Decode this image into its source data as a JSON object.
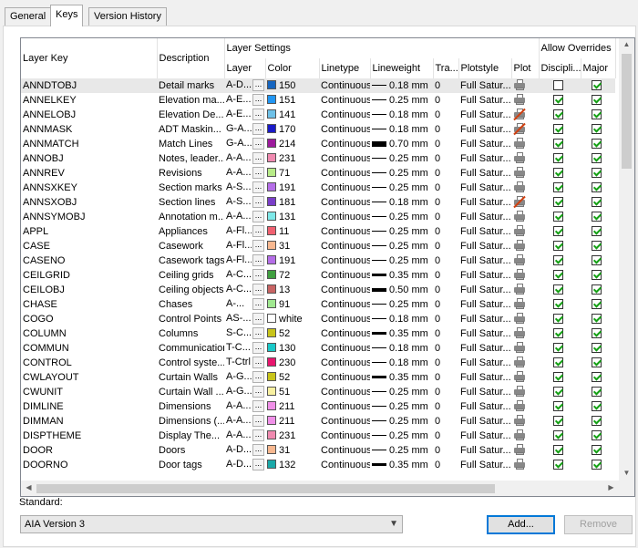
{
  "tabs": [
    "General",
    "Keys",
    "Version History"
  ],
  "headers": {
    "layer_key": "Layer Key",
    "description": "Description",
    "layer_settings": "Layer Settings",
    "layer": "Layer",
    "color": "Color",
    "linetype": "Linetype",
    "lineweight": "Lineweight",
    "transparency": "Tra...",
    "plotstyle": "Plotstyle",
    "plot": "Plot",
    "allow_overrides": "Allow Overrides",
    "discipline": "Discipli...",
    "major": "Major"
  },
  "browse_glyph": "...",
  "rows": [
    {
      "key": "ANNDTOBJ",
      "desc": "Detail marks",
      "layer": "A-D...",
      "color_hex": "#1565c0",
      "color": "150",
      "linetype": "Continuous",
      "lw": "0.18 mm",
      "tr": "0",
      "plotstyle": "Full Satur...",
      "plot": true,
      "disc": false,
      "major": true
    },
    {
      "key": "ANNELKEY",
      "desc": "Elevation ma...",
      "layer": "A-E...",
      "color_hex": "#2196f3",
      "color": "151",
      "linetype": "Continuous",
      "lw": "0.25 mm",
      "tr": "0",
      "plotstyle": "Full Satur...",
      "plot": true,
      "disc": true,
      "major": true
    },
    {
      "key": "ANNELOBJ",
      "desc": "Elevation De...",
      "layer": "A-E...",
      "color_hex": "#6ec1e8",
      "color": "141",
      "linetype": "Continuous",
      "lw": "0.18 mm",
      "tr": "0",
      "plotstyle": "Full Satur...",
      "plot": false,
      "disc": true,
      "major": true
    },
    {
      "key": "ANNMASK",
      "desc": "ADT Maskin...",
      "layer": "G-A...",
      "color_hex": "#1a1ac8",
      "color": "170",
      "linetype": "Continuous",
      "lw": "0.18 mm",
      "tr": "0",
      "plotstyle": "Full Satur...",
      "plot": false,
      "disc": true,
      "major": true
    },
    {
      "key": "ANNMATCH",
      "desc": "Match Lines",
      "layer": "G-A...",
      "color_hex": "#9c1a9c",
      "color": "214",
      "linetype": "Continuous",
      "lw": "0.70 mm",
      "tr": "0",
      "plotstyle": "Full Satur...",
      "plot": true,
      "disc": true,
      "major": true
    },
    {
      "key": "ANNOBJ",
      "desc": "Notes, leader...",
      "layer": "A-A...",
      "color_hex": "#f08ab0",
      "color": "231",
      "linetype": "Continuous",
      "lw": "0.25 mm",
      "tr": "0",
      "plotstyle": "Full Satur...",
      "plot": true,
      "disc": true,
      "major": true
    },
    {
      "key": "ANNREV",
      "desc": "Revisions",
      "layer": "A-A...",
      "color_hex": "#b8ec88",
      "color": "71",
      "linetype": "Continuous",
      "lw": "0.25 mm",
      "tr": "0",
      "plotstyle": "Full Satur...",
      "plot": true,
      "disc": true,
      "major": true
    },
    {
      "key": "ANNSXKEY",
      "desc": "Section marks",
      "layer": "A-S...",
      "color_hex": "#b56ee8",
      "color": "191",
      "linetype": "Continuous",
      "lw": "0.25 mm",
      "tr": "0",
      "plotstyle": "Full Satur...",
      "plot": true,
      "disc": true,
      "major": true
    },
    {
      "key": "ANNSXOBJ",
      "desc": "Section lines",
      "layer": "A-S...",
      "color_hex": "#7a3ec8",
      "color": "181",
      "linetype": "Continuous",
      "lw": "0.18 mm",
      "tr": "0",
      "plotstyle": "Full Satur...",
      "plot": false,
      "disc": true,
      "major": true
    },
    {
      "key": "ANNSYMOBJ",
      "desc": "Annotation m...",
      "layer": "A-A...",
      "color_hex": "#7ee8e8",
      "color": "131",
      "linetype": "Continuous",
      "lw": "0.25 mm",
      "tr": "0",
      "plotstyle": "Full Satur...",
      "plot": true,
      "disc": true,
      "major": true
    },
    {
      "key": "APPL",
      "desc": "Appliances",
      "layer": "A-Fl...",
      "color_hex": "#f06070",
      "color": "11",
      "linetype": "Continuous",
      "lw": "0.25 mm",
      "tr": "0",
      "plotstyle": "Full Satur...",
      "plot": true,
      "disc": true,
      "major": true
    },
    {
      "key": "CASE",
      "desc": "Casework",
      "layer": "A-Fl...",
      "color_hex": "#f8b890",
      "color": "31",
      "linetype": "Continuous",
      "lw": "0.25 mm",
      "tr": "0",
      "plotstyle": "Full Satur...",
      "plot": true,
      "disc": true,
      "major": true
    },
    {
      "key": "CASENO",
      "desc": "Casework tags",
      "layer": "A-Fl...",
      "color_hex": "#b56ee8",
      "color": "191",
      "linetype": "Continuous",
      "lw": "0.25 mm",
      "tr": "0",
      "plotstyle": "Full Satur...",
      "plot": true,
      "disc": true,
      "major": true
    },
    {
      "key": "CEILGRID",
      "desc": "Ceiling grids",
      "layer": "A-C...",
      "color_hex": "#40a040",
      "color": "72",
      "linetype": "Continuous",
      "lw": "0.35 mm",
      "tr": "0",
      "plotstyle": "Full Satur...",
      "plot": true,
      "disc": true,
      "major": true
    },
    {
      "key": "CEILOBJ",
      "desc": "Ceiling objects",
      "layer": "A-C...",
      "color_hex": "#c86464",
      "color": "13",
      "linetype": "Continuous",
      "lw": "0.50 mm",
      "tr": "0",
      "plotstyle": "Full Satur...",
      "plot": true,
      "disc": true,
      "major": true
    },
    {
      "key": "CHASE",
      "desc": "Chases",
      "layer": "A-...",
      "color_hex": "#a0e890",
      "color": "91",
      "linetype": "Continuous",
      "lw": "0.25 mm",
      "tr": "0",
      "plotstyle": "Full Satur...",
      "plot": true,
      "disc": true,
      "major": true
    },
    {
      "key": "COGO",
      "desc": "Control Points",
      "layer": "AS-...",
      "color_hex": "#ffffff",
      "color": "white",
      "linetype": "Continuous",
      "lw": "0.18 mm",
      "tr": "0",
      "plotstyle": "Full Satur...",
      "plot": true,
      "disc": true,
      "major": true
    },
    {
      "key": "COLUMN",
      "desc": "Columns",
      "layer": "S-C...",
      "color_hex": "#c8c41a",
      "color": "52",
      "linetype": "Continuous",
      "lw": "0.35 mm",
      "tr": "0",
      "plotstyle": "Full Satur...",
      "plot": true,
      "disc": true,
      "major": true
    },
    {
      "key": "COMMUN",
      "desc": "Communication",
      "layer": "T-C...",
      "color_hex": "#1ac8c8",
      "color": "130",
      "linetype": "Continuous",
      "lw": "0.18 mm",
      "tr": "0",
      "plotstyle": "Full Satur...",
      "plot": true,
      "disc": true,
      "major": true
    },
    {
      "key": "CONTROL",
      "desc": "Control syste...",
      "layer": "T-Ctrl",
      "color_hex": "#e8156e",
      "color": "230",
      "linetype": "Continuous",
      "lw": "0.18 mm",
      "tr": "0",
      "plotstyle": "Full Satur...",
      "plot": true,
      "disc": true,
      "major": true
    },
    {
      "key": "CWLAYOUT",
      "desc": "Curtain Walls",
      "layer": "A-G...",
      "color_hex": "#c8c41a",
      "color": "52",
      "linetype": "Continuous",
      "lw": "0.35 mm",
      "tr": "0",
      "plotstyle": "Full Satur...",
      "plot": true,
      "disc": true,
      "major": true
    },
    {
      "key": "CWUNIT",
      "desc": "Curtain Wall ...",
      "layer": "A-G...",
      "color_hex": "#f8f0a0",
      "color": "51",
      "linetype": "Continuous",
      "lw": "0.25 mm",
      "tr": "0",
      "plotstyle": "Full Satur...",
      "plot": true,
      "disc": true,
      "major": true
    },
    {
      "key": "DIMLINE",
      "desc": "Dimensions",
      "layer": "A-A...",
      "color_hex": "#f090e8",
      "color": "211",
      "linetype": "Continuous",
      "lw": "0.25 mm",
      "tr": "0",
      "plotstyle": "Full Satur...",
      "plot": true,
      "disc": true,
      "major": true
    },
    {
      "key": "DIMMAN",
      "desc": "Dimensions (...",
      "layer": "A-A...",
      "color_hex": "#f090e8",
      "color": "211",
      "linetype": "Continuous",
      "lw": "0.25 mm",
      "tr": "0",
      "plotstyle": "Full Satur...",
      "plot": true,
      "disc": true,
      "major": true
    },
    {
      "key": "DISPTHEME",
      "desc": "Display The...",
      "layer": "A-A...",
      "color_hex": "#f08ab0",
      "color": "231",
      "linetype": "Continuous",
      "lw": "0.25 mm",
      "tr": "0",
      "plotstyle": "Full Satur...",
      "plot": true,
      "disc": true,
      "major": true
    },
    {
      "key": "DOOR",
      "desc": "Doors",
      "layer": "A-D...",
      "color_hex": "#f8b890",
      "color": "31",
      "linetype": "Continuous",
      "lw": "0.25 mm",
      "tr": "0",
      "plotstyle": "Full Satur...",
      "plot": true,
      "disc": true,
      "major": true
    },
    {
      "key": "DOORNO",
      "desc": "Door tags",
      "layer": "A-D...",
      "color_hex": "#1aa8a8",
      "color": "132",
      "linetype": "Continuous",
      "lw": "0.35 mm",
      "tr": "0",
      "plotstyle": "Full Satur...",
      "plot": true,
      "disc": true,
      "major": true
    }
  ],
  "scroll_arrows": {
    "up": "▲",
    "down": "▼",
    "left": "◀",
    "right": "▶"
  },
  "standard": {
    "label": "Standard:",
    "value": "AIA Version 3",
    "dropdown_glyph": "▼"
  },
  "buttons": {
    "add": "Add...",
    "remove": "Remove"
  }
}
